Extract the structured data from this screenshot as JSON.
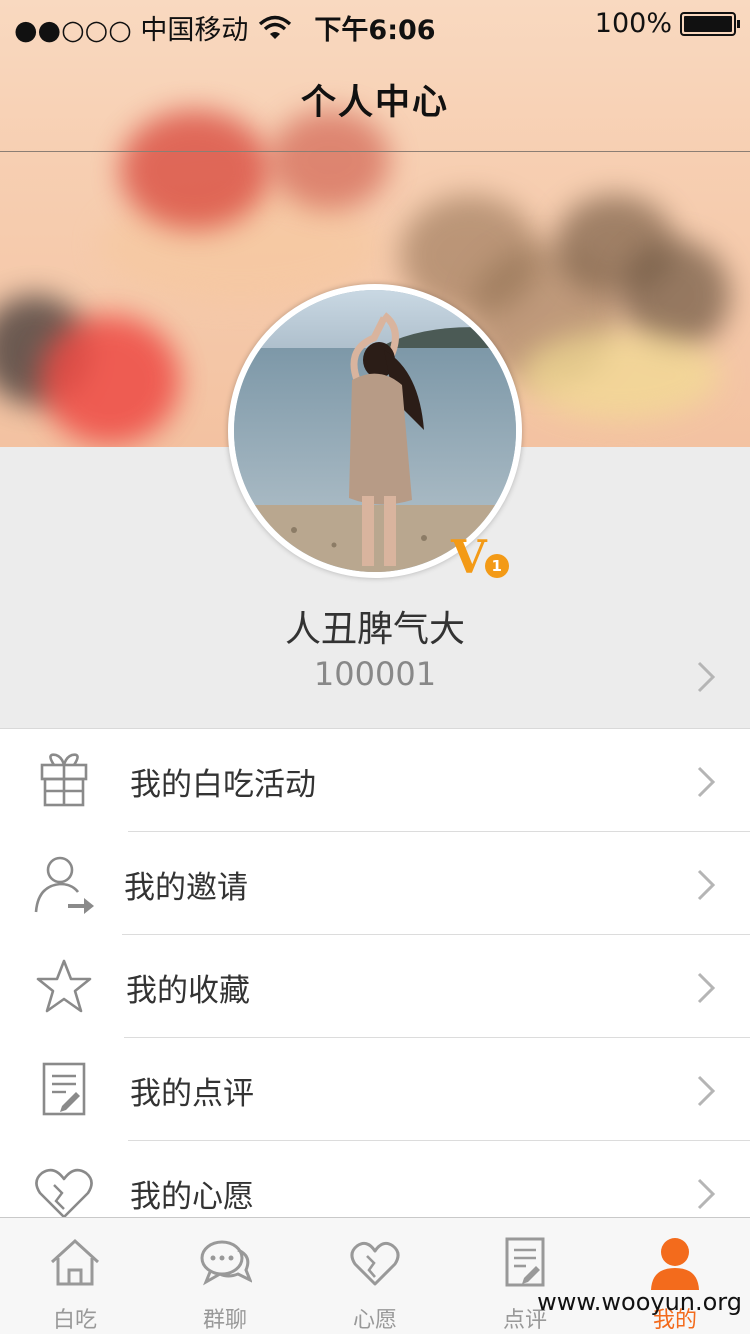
{
  "status_bar": {
    "carrier": "●●○○○ 中国移动",
    "time": "下午6:06",
    "battery": "100%"
  },
  "nav": {
    "title": "个人中心"
  },
  "profile": {
    "name": "人丑脾气大",
    "id": "100001",
    "vip_letter": "V",
    "vip_level": "1"
  },
  "menu": [
    {
      "label": "我的白吃活动",
      "icon": "gift-icon"
    },
    {
      "label": "我的邀请",
      "icon": "user-invite-icon"
    },
    {
      "label": "我的收藏",
      "icon": "star-icon"
    },
    {
      "label": "我的点评",
      "icon": "review-icon"
    },
    {
      "label": "我的心愿",
      "icon": "heart-icon"
    }
  ],
  "tabs": [
    {
      "label": "白吃",
      "icon": "home-icon"
    },
    {
      "label": "群聊",
      "icon": "chat-icon"
    },
    {
      "label": "心愿",
      "icon": "heart-icon"
    },
    {
      "label": "点评",
      "icon": "review-icon"
    },
    {
      "label": "我的",
      "icon": "person-icon",
      "active": true
    }
  ],
  "colors": {
    "accent": "#f36b1c",
    "vip": "#f39a16",
    "icon_gray": "#8a8a8a"
  },
  "watermark": "www.wooyun.org"
}
